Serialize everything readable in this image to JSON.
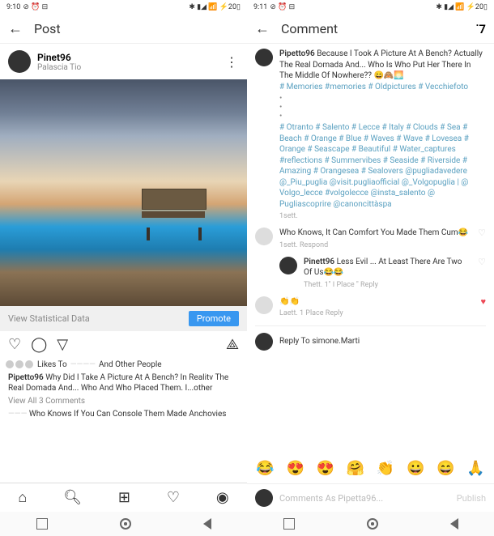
{
  "statusbar": {
    "time": "9:10",
    "time2": "9:11",
    "icons_left": "⊘ ⏰ ⊟",
    "icons_right": "✱ ▮◢ 📶 ⚡20▯"
  },
  "left": {
    "title": "Post",
    "username": "Pinet96",
    "location": "Palascia Tio",
    "stat_link": "View Statistical Data",
    "promote": "Promote",
    "likes_text": "Likes To",
    "likes_suffix": "And Other People",
    "caption_user": "Pipetto96",
    "caption_text": "Why Did I Take A Picture At A Bench? In Realitv The Real Domada And... Who And Who Placed Them. I...other",
    "view_comments": "View All 3 Comments",
    "comment_preview": "Who Knows If You Can Console Them Made Anchovies"
  },
  "right": {
    "title": "Comment",
    "count": "˙7",
    "main_user": "Pipetto96",
    "main_text": "Because I Took A Picture At A Bench? Actually The Real Domada And... Who Is Who Put Her There In The Middle Of Nowhere?? 😄🙈🌅",
    "tags1": "# Memories #memories # Oldpictures # Vecchiefoto",
    "tags2": "# Otranto # Salento # Lecce # Italy # Clouds # Sea # Beach # Orange # Blue # Waves # Wave # Lovesea # Orange # Seascape # Beautiful # Water_captures #reflections # Summervibes # Seaside # Riverside # Amazing # Orangesea # Sealovers @pugliadavedere @_Piu_puglia @visit.pugliaofficial @_Volgopuglia | @ Volgo_lecce #volgolecce @insta_salento @ Pugliascoprire @canoncittàspa",
    "tags_meta": "1sett.",
    "c1_text": "Who Knows, It Can Comfort You Made Them Cum😂",
    "c1_meta": "1sett. Respond",
    "c2_user": "Pinett96",
    "c2_text": "Less Evil ... At Least There Are Two Of Us😂😂",
    "c2_meta": "Thett. 1\" I Place \" Reply",
    "c3_text": "👏👏",
    "c3_meta": "Laett. 1 Place Reply",
    "reply_to": "Reply To    simone.Marti",
    "emojis": [
      "😂",
      "😍",
      "😍",
      "🤗",
      "👏",
      "😀",
      "😄",
      "🙏"
    ],
    "input_placeholder": "Comments As Pipetta96...",
    "publish": "Publish"
  }
}
